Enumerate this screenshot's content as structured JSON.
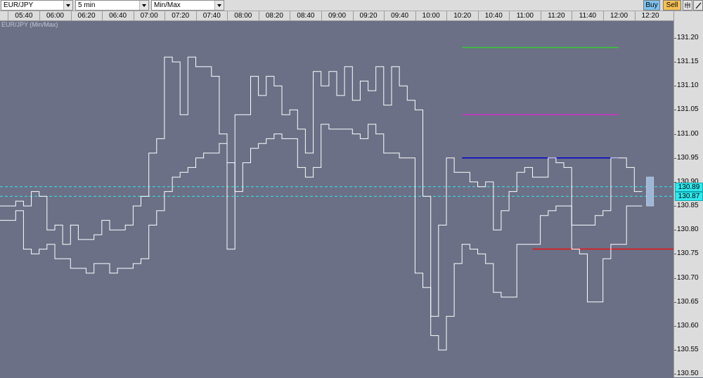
{
  "toolbar": {
    "symbol": "EUR/JPY",
    "timeframe": "5 min",
    "chart_mode": "Min/Max",
    "buy_label": "Buy",
    "sell_label": "Sell",
    "settings_icon": "settings-icon",
    "draw_icon": "pencil-icon"
  },
  "colors": {
    "background": "#6b7086",
    "series": "#ffffff",
    "current_price": "#30e8ee",
    "level_green": "#33cc33",
    "level_magenta": "#cc33cc",
    "level_blue": "#0000cc",
    "level_red": "#ee1111"
  },
  "chart_data": {
    "type": "line",
    "title": "EUR/JPY (Min/Max)",
    "x_ticks": [
      "05:40",
      "06:00",
      "06:20",
      "06:40",
      "07:00",
      "07:20",
      "07:40",
      "08:00",
      "08:20",
      "08:40",
      "09:00",
      "09:20",
      "09:40",
      "10:00",
      "10:20",
      "10:40",
      "11:00",
      "11:20",
      "11:40",
      "12:00",
      "12:20"
    ],
    "y_ticks": [
      131.2,
      131.15,
      131.1,
      131.05,
      131.0,
      130.95,
      130.9,
      130.85,
      130.8,
      130.75,
      130.7,
      130.65,
      130.6,
      130.55,
      130.5
    ],
    "ylim": [
      130.493,
      131.235
    ],
    "xlim": [
      "05:25",
      "12:35"
    ],
    "grid": false,
    "current_prices": [
      130.89,
      130.87
    ],
    "series": [
      {
        "name": "Max",
        "x": [
          "05:30",
          "05:35",
          "05:40",
          "05:45",
          "05:50",
          "05:55",
          "06:00",
          "06:05",
          "06:10",
          "06:15",
          "06:20",
          "06:25",
          "06:30",
          "06:35",
          "06:40",
          "06:45",
          "06:50",
          "06:55",
          "07:00",
          "07:05",
          "07:10",
          "07:15",
          "07:20",
          "07:25",
          "07:30",
          "07:35",
          "07:40",
          "07:45",
          "07:50",
          "07:55",
          "08:00",
          "08:05",
          "08:10",
          "08:15",
          "08:20",
          "08:25",
          "08:30",
          "08:35",
          "08:40",
          "08:45",
          "08:50",
          "08:55",
          "09:00",
          "09:05",
          "09:10",
          "09:15",
          "09:20",
          "09:25",
          "09:30",
          "09:35",
          "09:40",
          "09:45",
          "09:50",
          "09:55",
          "10:00",
          "10:05",
          "10:10",
          "10:15",
          "10:20",
          "10:25",
          "10:30",
          "10:35",
          "10:40",
          "10:45",
          "10:50",
          "10:55",
          "11:00",
          "11:05",
          "11:10",
          "11:15",
          "11:20",
          "11:25",
          "11:30",
          "11:35",
          "11:40",
          "11:45",
          "11:50",
          "11:55",
          "12:00",
          "12:05",
          "12:10"
        ],
        "values": [
          130.85,
          130.86,
          130.85,
          130.88,
          130.87,
          130.8,
          130.81,
          130.77,
          130.81,
          130.78,
          130.78,
          130.79,
          130.82,
          130.8,
          130.8,
          130.81,
          130.85,
          130.87,
          130.96,
          130.99,
          131.16,
          131.15,
          131.04,
          131.16,
          131.14,
          131.14,
          131.12,
          131.0,
          130.76,
          131.04,
          131.04,
          131.12,
          131.08,
          131.12,
          131.1,
          131.04,
          131.05,
          131.01,
          130.96,
          131.13,
          131.1,
          131.13,
          131.08,
          131.14,
          131.07,
          131.11,
          131.09,
          131.14,
          131.06,
          131.14,
          131.1,
          131.07,
          131.05,
          130.87,
          130.62,
          130.81,
          130.95,
          130.92,
          130.92,
          130.9,
          130.89,
          130.9,
          130.8,
          130.84,
          130.88,
          130.92,
          130.93,
          130.91,
          130.91,
          130.95,
          130.94,
          130.93,
          130.81,
          130.81,
          130.81,
          130.83,
          130.84,
          130.95,
          130.95,
          130.93,
          130.88
        ]
      },
      {
        "name": "Min",
        "x": [
          "05:30",
          "05:35",
          "05:40",
          "05:45",
          "05:50",
          "05:55",
          "06:00",
          "06:05",
          "06:10",
          "06:15",
          "06:20",
          "06:25",
          "06:30",
          "06:35",
          "06:40",
          "06:45",
          "06:50",
          "06:55",
          "07:00",
          "07:05",
          "07:10",
          "07:15",
          "07:20",
          "07:25",
          "07:30",
          "07:35",
          "07:40",
          "07:45",
          "07:50",
          "07:55",
          "08:00",
          "08:05",
          "08:10",
          "08:15",
          "08:20",
          "08:25",
          "08:30",
          "08:35",
          "08:40",
          "08:45",
          "08:50",
          "08:55",
          "09:00",
          "09:05",
          "09:10",
          "09:15",
          "09:20",
          "09:25",
          "09:30",
          "09:35",
          "09:40",
          "09:45",
          "09:50",
          "09:55",
          "10:00",
          "10:05",
          "10:10",
          "10:15",
          "10:20",
          "10:25",
          "10:30",
          "10:35",
          "10:40",
          "10:45",
          "10:50",
          "10:55",
          "11:00",
          "11:05",
          "11:10",
          "11:15",
          "11:20",
          "11:25",
          "11:30",
          "11:35",
          "11:40",
          "11:45",
          "11:50",
          "11:55",
          "12:00",
          "12:05",
          "12:10"
        ],
        "values": [
          130.82,
          130.84,
          130.76,
          130.75,
          130.76,
          130.77,
          130.74,
          130.74,
          130.72,
          130.72,
          130.71,
          130.73,
          130.73,
          130.71,
          130.72,
          130.72,
          130.73,
          130.74,
          130.81,
          130.84,
          130.88,
          130.91,
          130.92,
          130.93,
          130.95,
          130.96,
          130.96,
          130.98,
          130.94,
          130.88,
          130.94,
          130.97,
          130.98,
          130.99,
          131.0,
          130.99,
          130.99,
          130.93,
          130.91,
          130.93,
          131.02,
          131.01,
          131.01,
          131.01,
          131.0,
          130.99,
          131.02,
          131.0,
          130.96,
          130.96,
          130.95,
          130.95,
          130.71,
          130.68,
          130.58,
          130.55,
          130.62,
          130.73,
          130.77,
          130.76,
          130.75,
          130.73,
          130.67,
          130.66,
          130.66,
          130.77,
          130.77,
          130.77,
          130.83,
          130.84,
          130.85,
          130.85,
          130.76,
          130.75,
          130.65,
          130.65,
          130.74,
          130.77,
          130.77,
          130.85,
          130.85
        ]
      }
    ],
    "levels": [
      {
        "color": "green",
        "value": 131.18,
        "x_start": "10:20",
        "x_end": "12:00"
      },
      {
        "color": "magenta",
        "value": 131.04,
        "x_start": "10:20",
        "x_end": "12:00"
      },
      {
        "color": "blue",
        "value": 130.95,
        "x_start": "10:20",
        "x_end": "12:00"
      },
      {
        "color": "red",
        "value": 130.76,
        "x_start": "11:05",
        "x_end": "12:35"
      }
    ],
    "guides": [
      130.89,
      130.87
    ],
    "current_candle": {
      "x": "12:20",
      "high": 130.91,
      "low": 130.85
    }
  }
}
